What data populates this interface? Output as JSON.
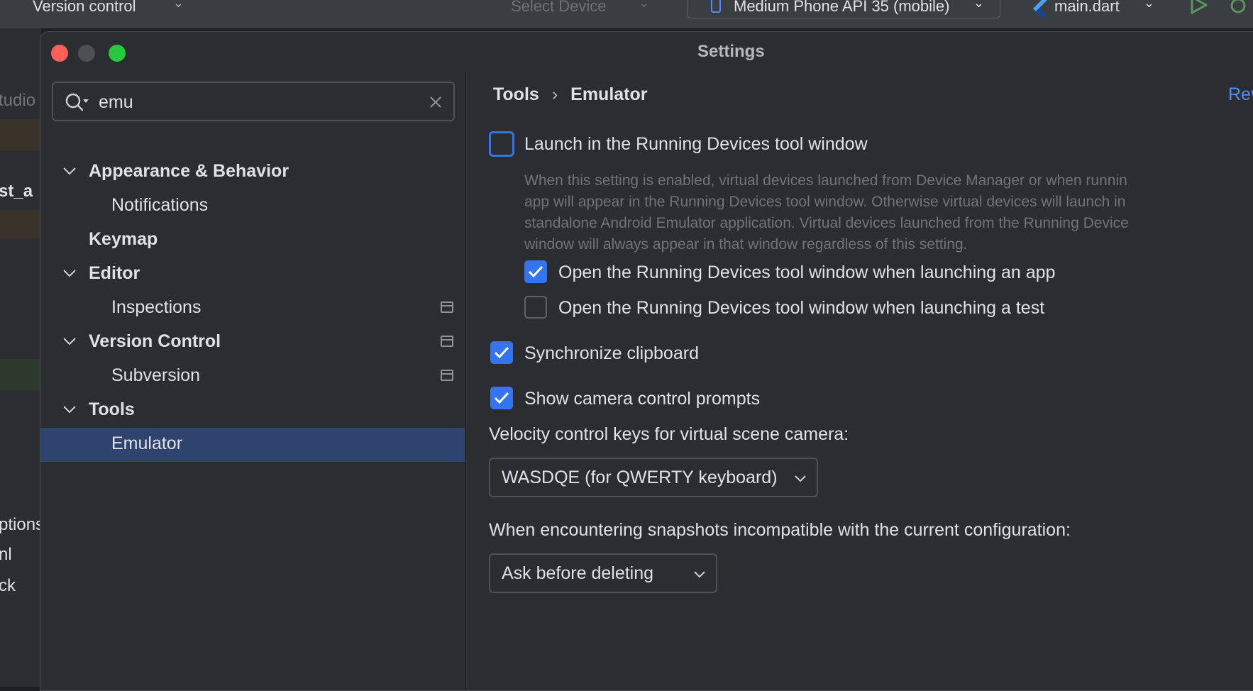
{
  "ide": {
    "topbar": {
      "vcs_label": "Version control",
      "device_select_placeholder": "Select Device",
      "device_label": "Medium Phone API 35 (mobile)",
      "run_config_label": "main.dart"
    },
    "left_fragments": [
      "tudio",
      "st_a",
      "ptions",
      "nl",
      "ck"
    ]
  },
  "dialog": {
    "title": "Settings",
    "search": {
      "value": "emu"
    },
    "tree": [
      {
        "label": "Appearance & Behavior",
        "bold": true,
        "expanded": true
      },
      {
        "label": "Notifications",
        "bold": false
      },
      {
        "label": "Keymap",
        "bold": true
      },
      {
        "label": "Editor",
        "bold": true,
        "expanded": true
      },
      {
        "label": "Inspections",
        "bold": false,
        "badge": true
      },
      {
        "label": "Version Control",
        "bold": true,
        "expanded": true,
        "badge": true
      },
      {
        "label": "Subversion",
        "bold": false,
        "badge": true
      },
      {
        "label": "Tools",
        "bold": true,
        "expanded": true
      },
      {
        "label": "Emulator",
        "bold": false,
        "selected": true
      }
    ],
    "breadcrumb": {
      "parent": "Tools",
      "current": "Emulator"
    },
    "revert_label": "Revert c",
    "options": {
      "launch_in_running_devices": {
        "label": "Launch in the Running Devices tool window",
        "checked": false,
        "description": [
          "When this setting is enabled, virtual devices launched from Device Manager or when runnin",
          "app will appear in the Running Devices tool window. Otherwise virtual devices will launch in",
          "standalone Android Emulator application. Virtual devices launched from the Running Device",
          "window will always appear in that window regardless of this setting."
        ]
      },
      "open_on_app_launch": {
        "label": "Open the Running Devices tool window when launching an app",
        "checked": true
      },
      "open_on_test_launch": {
        "label": "Open the Running Devices tool window when launching a test",
        "checked": false
      },
      "sync_clipboard": {
        "label": "Synchronize clipboard",
        "checked": true
      },
      "camera_prompts": {
        "label": "Show camera control prompts",
        "checked": true
      }
    },
    "velocity": {
      "label": "Velocity control keys for virtual scene camera:",
      "selected": "WASDQE (for QWERTY keyboard)"
    },
    "snapshots": {
      "label": "When encountering snapshots incompatible with the current configuration:",
      "selected": "Ask before deleting"
    }
  },
  "colors": {
    "accent": "#3574f0",
    "link": "#548af7",
    "selection": "#2e436e",
    "background": "#2b2d30",
    "close": "#fe5f57",
    "maximize": "#28c840"
  }
}
